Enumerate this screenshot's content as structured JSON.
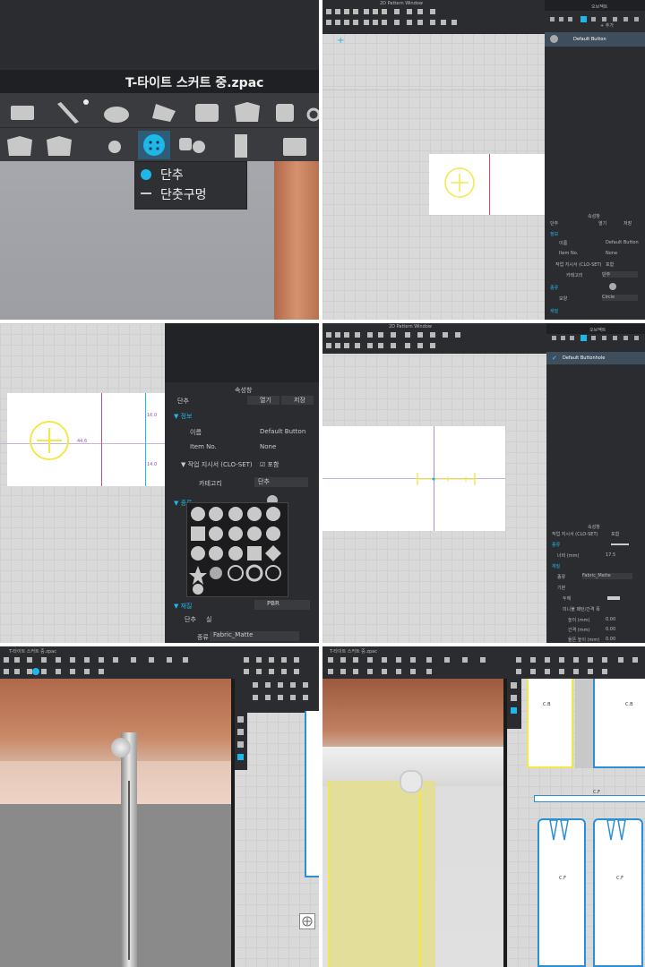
{
  "panel1": {
    "window_title": "T-타이트 스커트 중.zpac",
    "menu": {
      "item1": "단추",
      "item2": "단춧구멍"
    }
  },
  "panel2": {
    "window_title": "2D Pattern Window",
    "right_header": "오브젝트",
    "add_label": "+ 추가",
    "list_item": "Default Button",
    "props_header": "속성창",
    "load_label": "열기",
    "save_label": "저장",
    "button_label": "단추",
    "info": "정보",
    "name_label": "이름",
    "name_value": "Default Button",
    "item_no_label": "Item No.",
    "item_no_value": "None",
    "work_label": "작업 지시서 (CLO-SET)",
    "work_value": "포함",
    "category_label": "카테고리",
    "category_value": "단추",
    "type_label": "종류",
    "shape_label": "모양",
    "shape_value": "Circle",
    "material_label": "재질"
  },
  "panel3": {
    "props_header": "속성창",
    "button_label": "단추",
    "load_label": "열기",
    "save_label": "저장",
    "info": "정보",
    "name_label": "이름",
    "name_value": "Default Button",
    "item_no_label": "Item No.",
    "item_no_value": "None",
    "work_label": "작업 지시서 (CLO-SET)",
    "work_value": "포함",
    "category_label": "카테고리",
    "category_value": "단추",
    "type_label": "종류",
    "material_label": "재질",
    "material_value": "PBR",
    "tab_button": "단추",
    "tab_thread": "실",
    "kind_label": "종류",
    "kind_value": "Fabric_Matte",
    "dim1": "16.0",
    "dim2": "14.0",
    "dim3": "44.6"
  },
  "panel4": {
    "window_title": "2D Pattern Window",
    "right_header": "오브젝트",
    "list_item": "Default Buttonhole",
    "props_header": "속성창",
    "work_label": "작업 지시서 (CLO-SET)",
    "work_value": "포함",
    "type_label": "종류",
    "size_label": "너비 (mm)",
    "size_value": "17.5",
    "material_label": "재질",
    "kind_label": "종류",
    "kind_value": "Fabric_Matte",
    "thread_label": "기본",
    "thread_sub": "두께",
    "mini_label": "미니불 패턴/간격 폭",
    "w_label": "높이 (mm)",
    "w_value": "0.00",
    "h_label": "간격 (mm)",
    "h_value": "0.00",
    "d_label": "들뜬 높이 (mm)",
    "d_value": "0.00"
  },
  "panel5": {
    "window_title": "T-타이트 스커트 중.zpac"
  },
  "panel6": {
    "window_title": "T-타이트 스커트 중.zpac",
    "label_cb": "C.B",
    "label_cf_top": "C.F",
    "label_cf1": "C.F",
    "label_cf2": "C.F"
  },
  "colors": {
    "accent": "#1fb6e8",
    "dark_bg": "#2b2c30",
    "grid_bg": "#d9d9d9",
    "yellow": "#f3e84a",
    "red_line": "#d04a6a"
  }
}
